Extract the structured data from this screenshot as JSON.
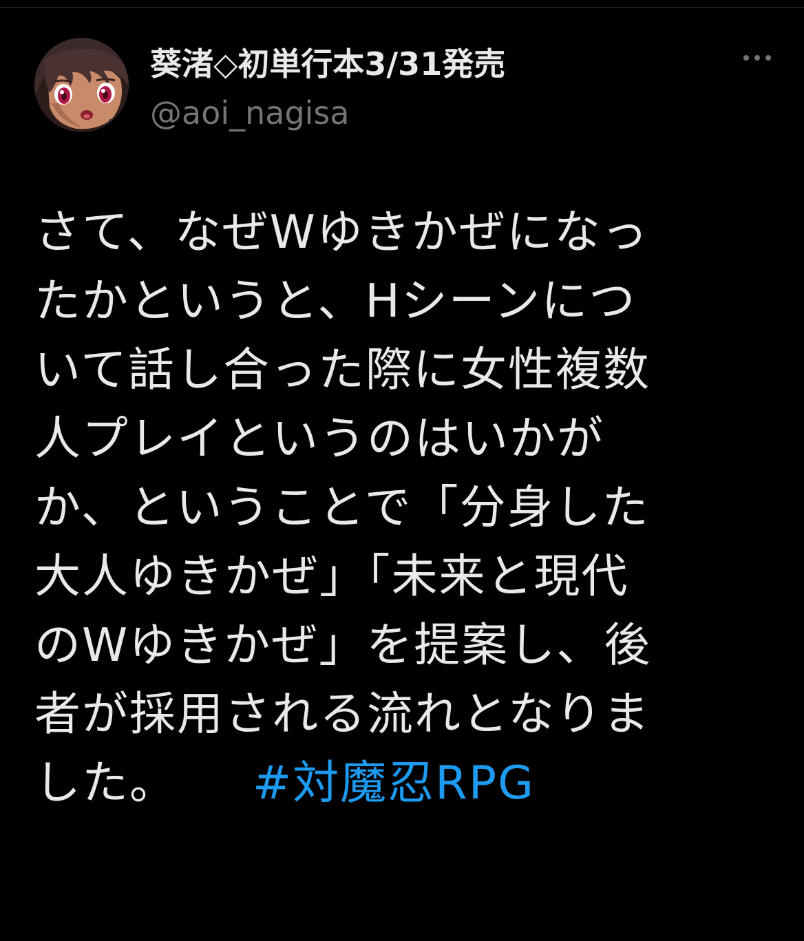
{
  "author": {
    "display_name": "葵渚◇初単行本3/31発売",
    "handle": "@aoi_nagisa",
    "avatar_icon": "anime-girl-avatar"
  },
  "menu": {
    "more_icon": "more-horizontal-icon"
  },
  "tweet": {
    "lines": [
      "さて、なぜWゆきかぜになっ",
      "たかというと、Hシーンにつ",
      "いて話し合った際に女性複数",
      "人プレイというのはいかが",
      "か、ということで「分身した",
      "大人ゆきかぜ」「未来と現代",
      "のWゆきかぜ」を提案し、後",
      "者が採用される流れとなりま",
      "した。"
    ],
    "hashtag": "#対魔忍RPG"
  },
  "colors": {
    "background": "#000000",
    "text": "#e7e9ea",
    "secondary_text": "#71767b",
    "link": "#1d9bf0",
    "divider": "#2f3336"
  }
}
